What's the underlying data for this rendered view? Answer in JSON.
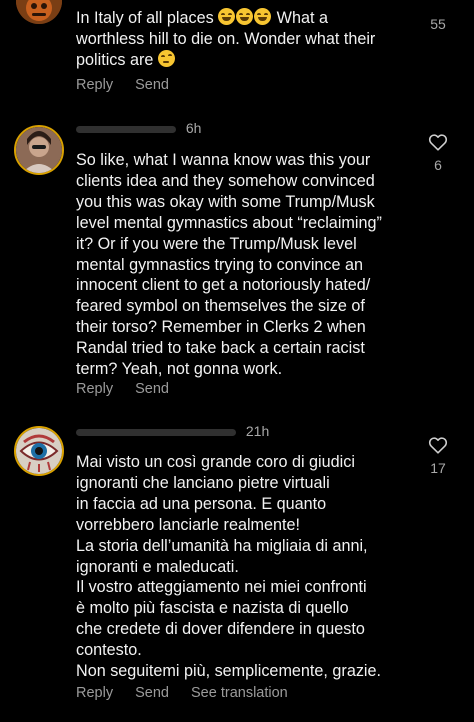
{
  "comments": [
    {
      "username": "",
      "time": "",
      "lines": [
        "In Italy of all places",
        "worthless hill to die on. Wonder what their",
        "politics are"
      ],
      "line1_suffix": "What a",
      "likes": "55",
      "reply": "Reply",
      "send": "Send"
    },
    {
      "username": "",
      "time": "6h",
      "lines": [
        "So like, what I wanna know was this your",
        "clients idea and they somehow convinced",
        "you this was okay with some Trump/Musk",
        "level mental gymnastics about “reclaiming”",
        "it? Or if you were the Trump/Musk level",
        "mental gymnastics trying to convince an",
        "innocent client to get a notoriously hated/",
        "feared symbol on themselves the size of",
        "their torso? Remember in Clerks 2 when",
        "Randal tried to take back a certain racist",
        "term? Yeah, not gonna work."
      ],
      "likes": "6",
      "reply": "Reply",
      "send": "Send"
    },
    {
      "username": "",
      "time": "21h",
      "lines": [
        "Mai visto un così grande coro di giudici",
        "ignoranti che lanciano pietre virtuali",
        "in faccia ad una persona. E quanto",
        "vorrebbero lanciarle realmente!",
        "La storia dell’umanità ha migliaia di anni,",
        "ignoranti e maleducati.",
        "Il vostro atteggiamento nei miei confronti",
        "è molto più fascista e nazista di quello",
        "che credete di dover difendere in questo",
        "contesto.",
        "Non seguitemi più, semplicemente, grazie."
      ],
      "likes": "17",
      "reply": "Reply",
      "send": "Send",
      "see_translation": "See translation"
    }
  ],
  "colors": {
    "background": "#000000",
    "text": "#f2f2f2",
    "secondary": "#a8a8a8",
    "action": "#9b9b9b"
  },
  "icons": [
    "heart-outline-icon",
    "grinning-face-emoji",
    "thinking-face-emoji"
  ]
}
